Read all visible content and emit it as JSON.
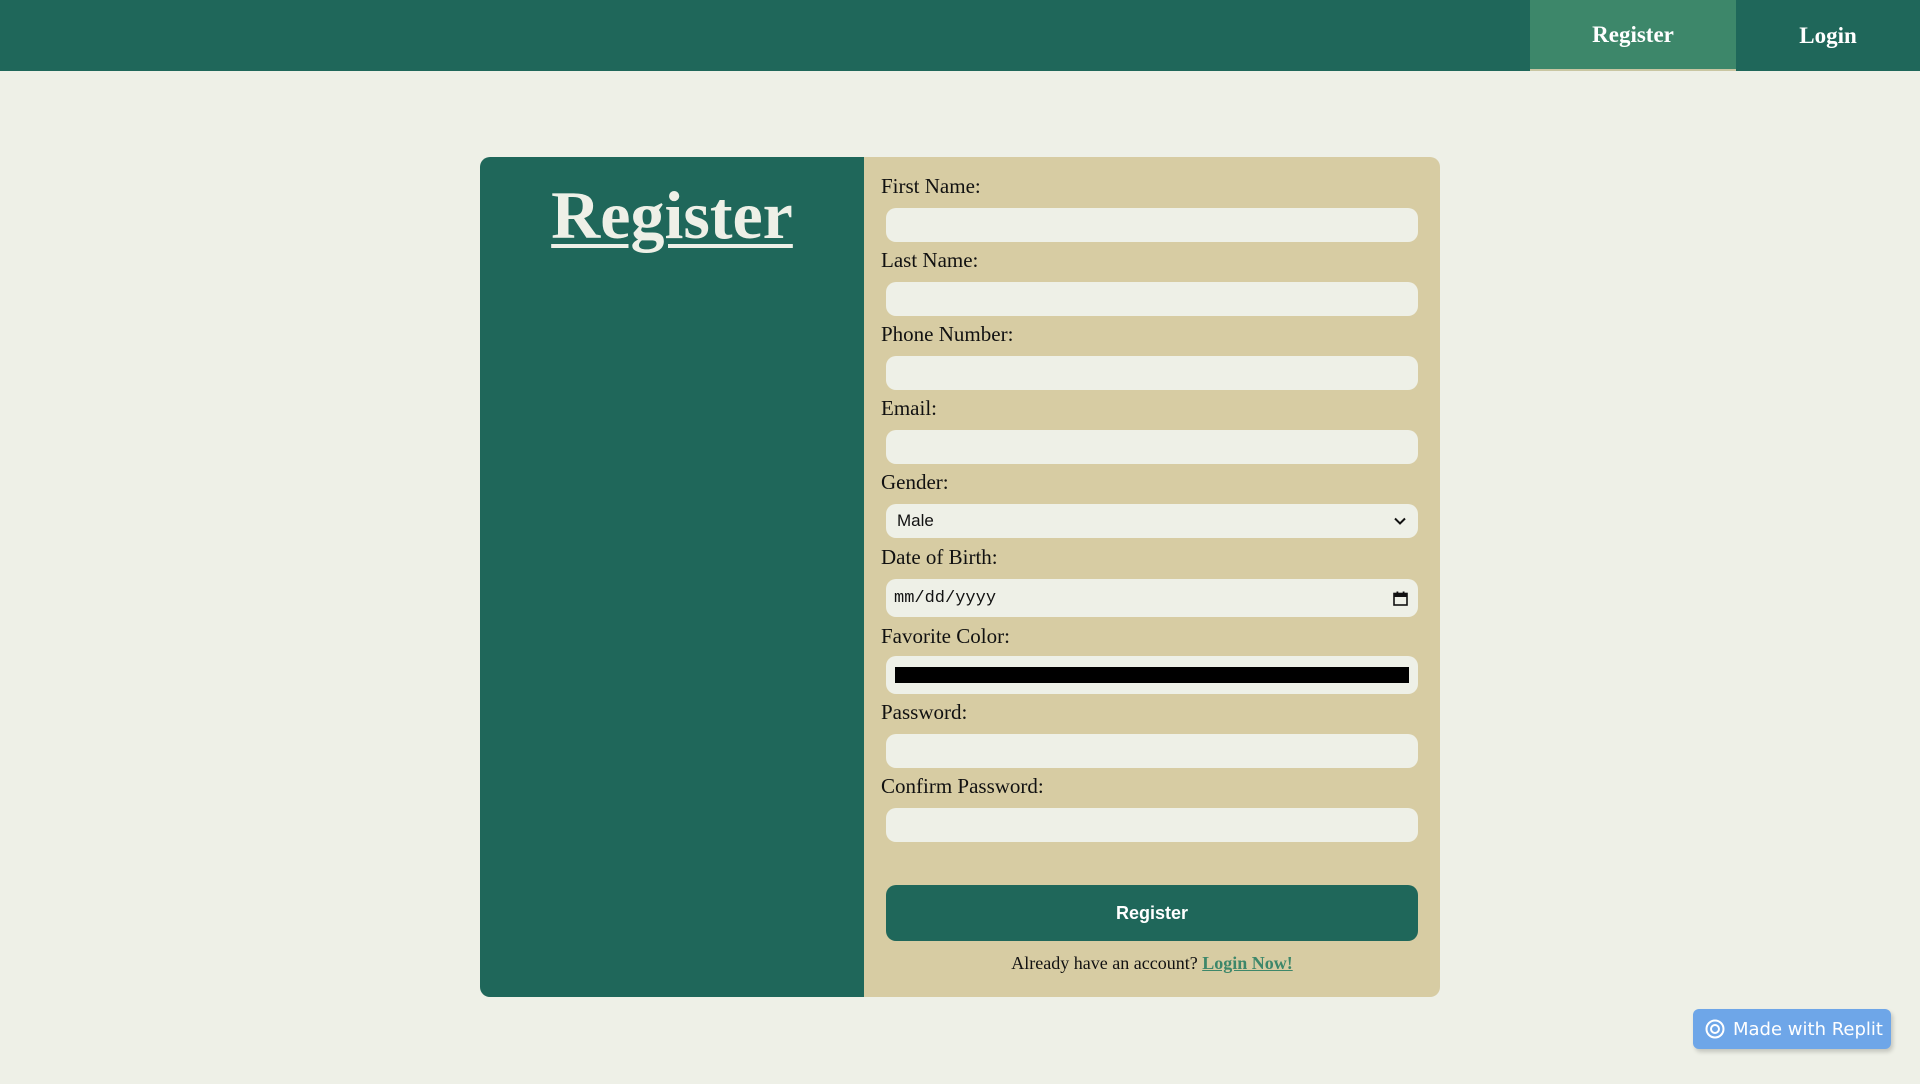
{
  "nav": {
    "register_label": "Register",
    "login_label": "Login"
  },
  "card": {
    "title": "Register"
  },
  "form": {
    "fields": [
      {
        "label": "First Name:",
        "value": ""
      },
      {
        "label": "Last Name:",
        "value": ""
      },
      {
        "label": "Phone Number:",
        "value": ""
      },
      {
        "label": "Email:",
        "value": ""
      },
      {
        "label": "Gender:",
        "value": "Male"
      },
      {
        "label": "Date of Birth:",
        "value": "mm/dd/yyyy"
      },
      {
        "label": "Favorite Color:",
        "value": "#000000"
      },
      {
        "label": "Password:",
        "value": ""
      },
      {
        "label": "Confirm Password:",
        "value": ""
      }
    ],
    "submit_label": "Register",
    "login_prompt": "Already have an account?",
    "login_link": "Login Now!"
  },
  "badge": {
    "label": "Made with Replit",
    "icon": "replit-icon"
  },
  "colors": {
    "primary_green": "#1f675a",
    "accent_green": "#3d876a",
    "form_bg": "#d7cca3",
    "page_bg": "#eef0e7",
    "badge_blue": "#6ea6e8"
  }
}
